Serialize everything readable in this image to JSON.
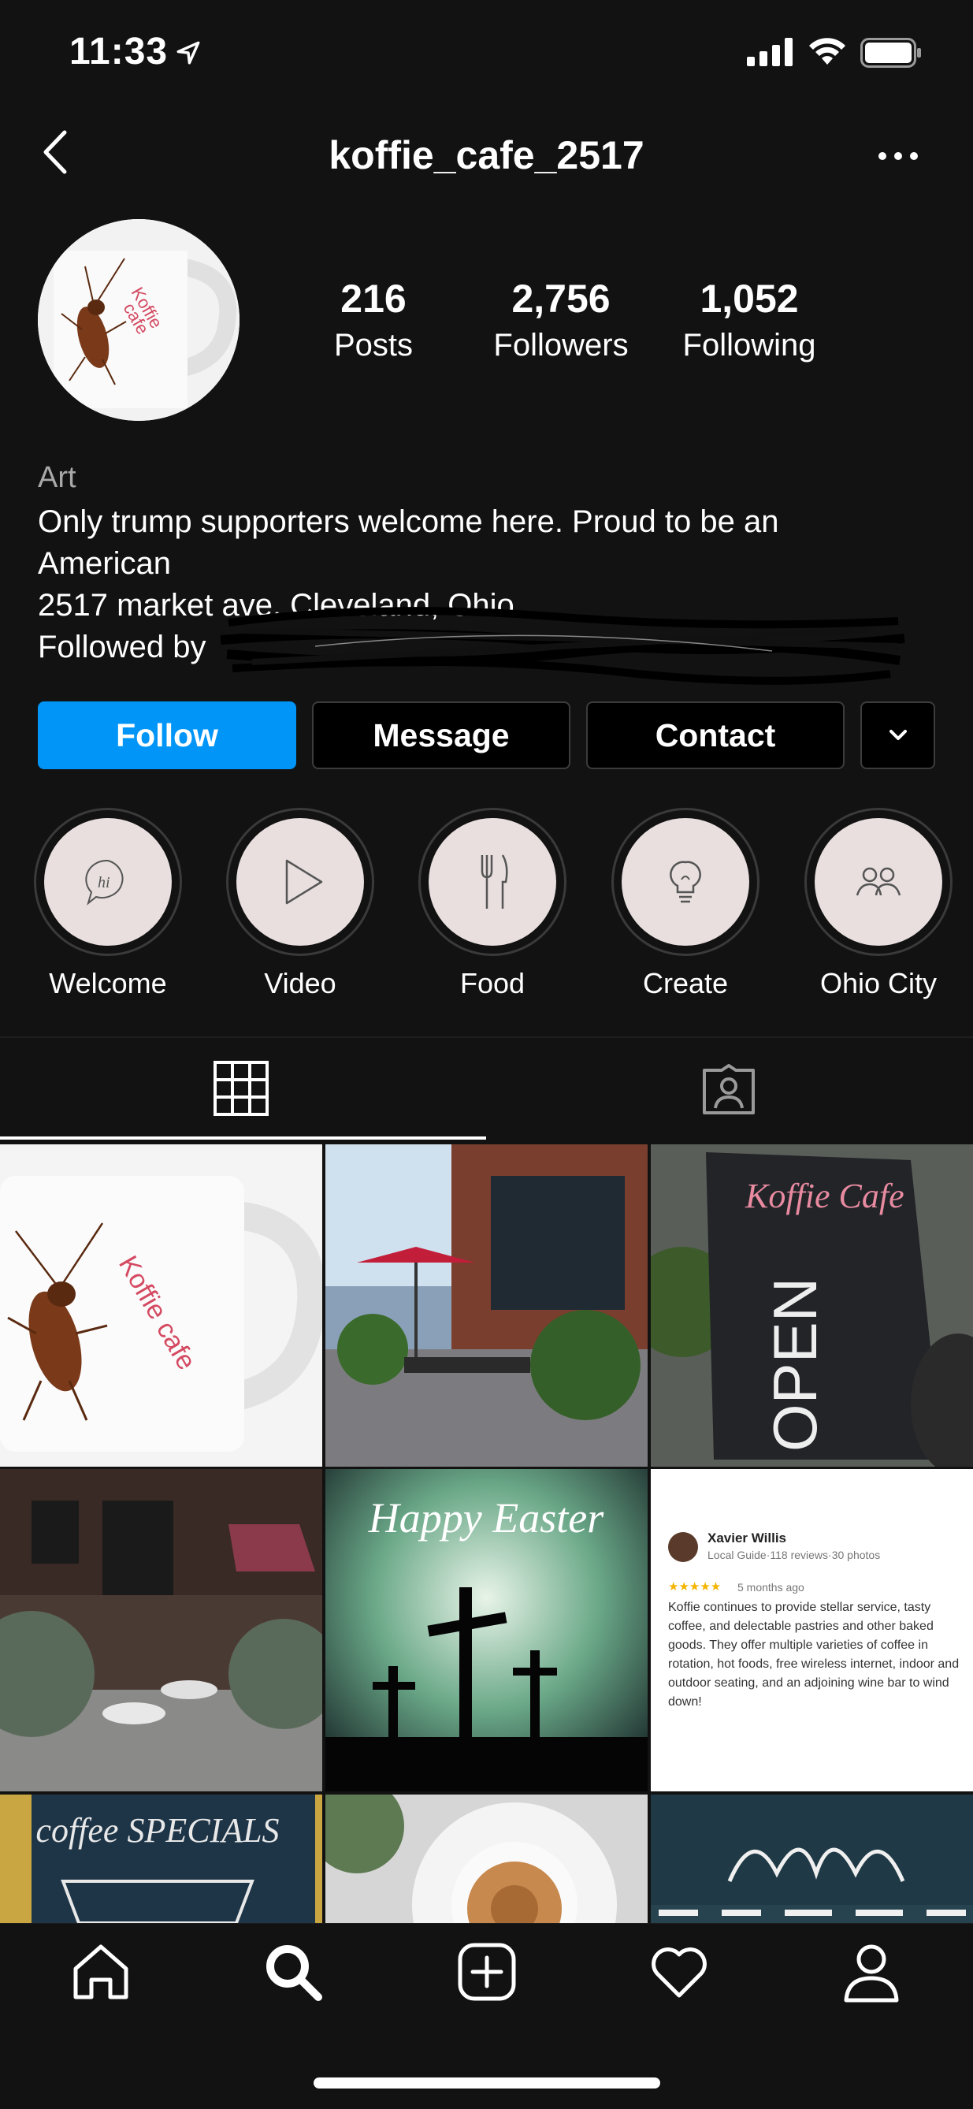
{
  "status_bar": {
    "time": "11:33"
  },
  "nav": {
    "username": "koffie_cafe_2517"
  },
  "profile": {
    "stats": [
      {
        "value": "216",
        "label": "Posts"
      },
      {
        "value": "2,756",
        "label": "Followers"
      },
      {
        "value": "1,052",
        "label": "Following"
      }
    ],
    "category": "Art",
    "bio_lines": [
      "Only trump supporters welcome here. Proud to be an",
      "American",
      "2517 market ave, Cleveland, Ohio"
    ],
    "followed_by": "Followed by"
  },
  "buttons": {
    "follow": "Follow",
    "message": "Message",
    "contact": "Contact"
  },
  "highlights": [
    {
      "label": "Welcome",
      "icon": "chat-hi-icon"
    },
    {
      "label": "Video",
      "icon": "play-icon"
    },
    {
      "label": "Food",
      "icon": "fork-knife-icon"
    },
    {
      "label": "Create",
      "icon": "lightbulb-icon"
    },
    {
      "label": "Ohio City",
      "icon": "people-icon"
    }
  ],
  "posts": {
    "mug_text": "Koffie cafe",
    "sign_title": "Koffie Cafe",
    "sign_open": "OPEN",
    "easter_text": "Happy Easter",
    "review": {
      "name": "Xavier Willis",
      "subtitle": "Local Guide·118 reviews·30 photos",
      "stars": "★★★★★",
      "when": "5 months ago",
      "text": "Koffie continues to provide stellar service, tasty coffee, and delectable pastries and other baked goods. They offer multiple varieties of coffee in rotation, hot foods, free wireless internet, indoor and outdoor seating, and an adjoining wine bar to wind down!"
    },
    "specials_text": "coffee SPECIALS"
  },
  "colors": {
    "background": "#121212",
    "follow_button": "#0095f6",
    "highlight_fill": "#e8dfde"
  }
}
